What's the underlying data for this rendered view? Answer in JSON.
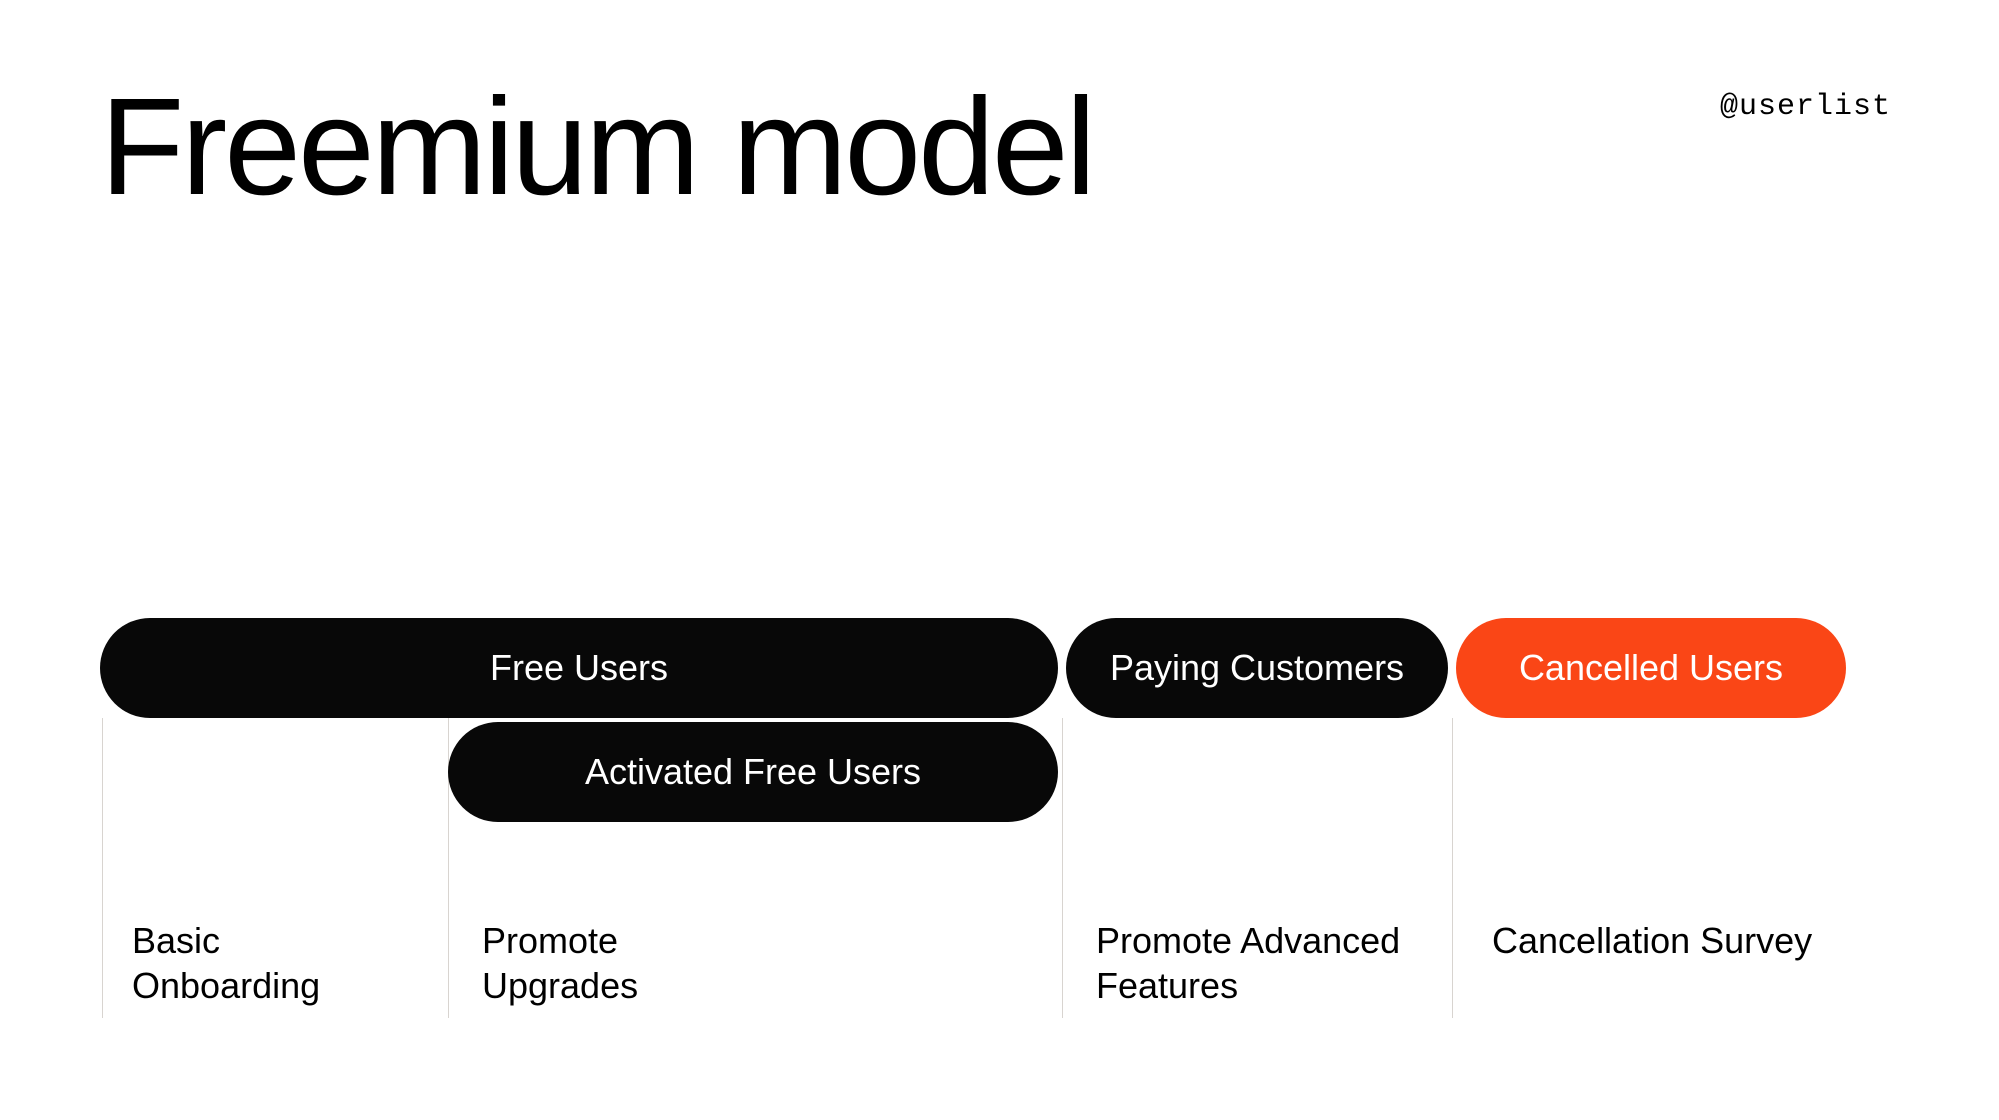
{
  "title": "Freemium model",
  "handle": "@userlist",
  "pills": {
    "free": "Free Users",
    "activated": "Activated Free Users",
    "paying": "Paying Customers",
    "cancelled": "Cancelled Users"
  },
  "captions": {
    "basic_onboarding": "Basic\nOnboarding",
    "promote_upgrades": "Promote\nUpgrades",
    "promote_advanced": "Promote Advanced\nFeatures",
    "cancellation_survey": "Cancellation Survey"
  },
  "colors": {
    "black": "#080808",
    "orange": "#fa4616",
    "divider": "#d8d4d0"
  }
}
